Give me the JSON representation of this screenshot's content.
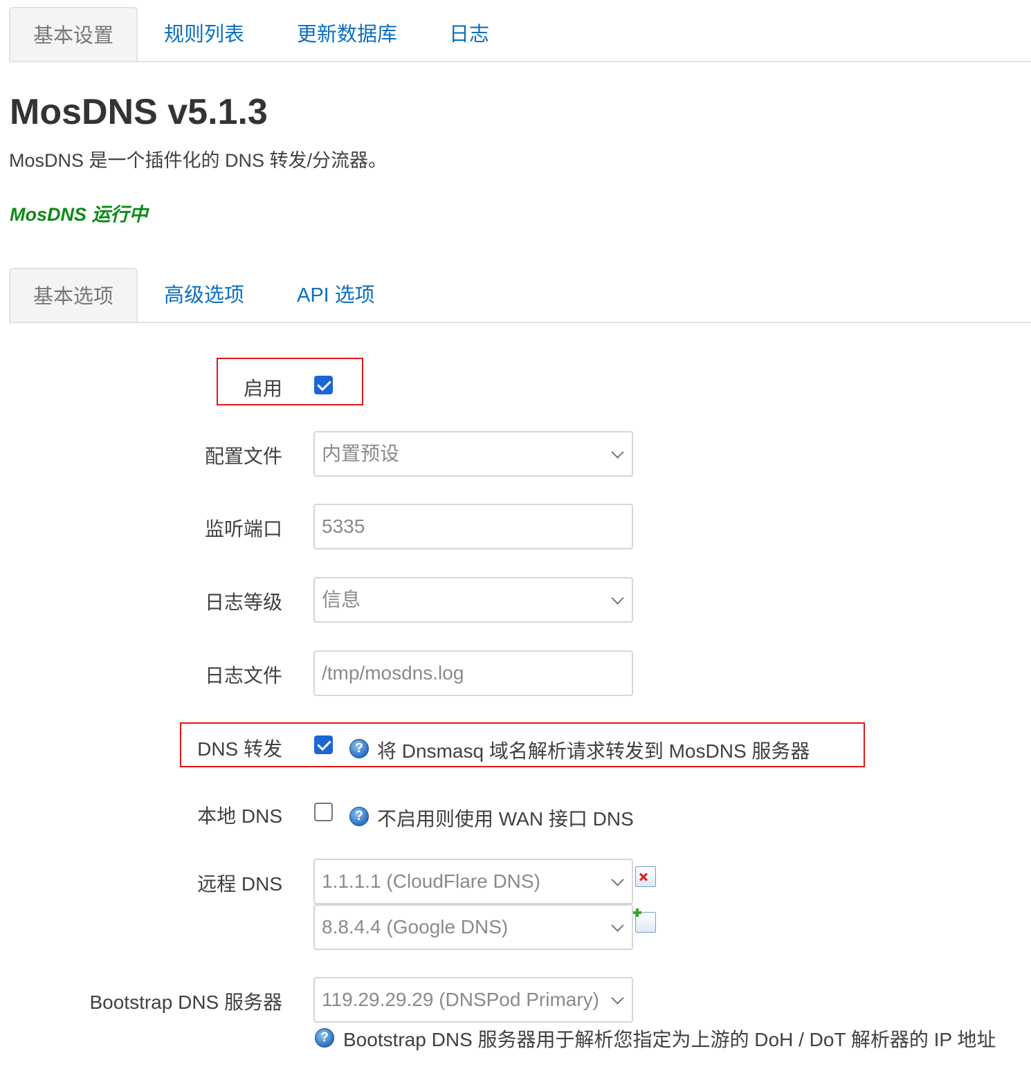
{
  "top_tabs": [
    "基本设置",
    "规则列表",
    "更新数据库",
    "日志"
  ],
  "title": "MosDNS v5.1.3",
  "description": "MosDNS 是一个插件化的 DNS 转发/分流器。",
  "status": "MosDNS 运行中",
  "sub_tabs": [
    "基本选项",
    "高级选项",
    "API 选项"
  ],
  "form": {
    "enable": {
      "label": "启用",
      "checked": true
    },
    "config_file": {
      "label": "配置文件",
      "value": "内置预设"
    },
    "listen_port": {
      "label": "监听端口",
      "value": "5335"
    },
    "log_level": {
      "label": "日志等级",
      "value": "信息"
    },
    "log_file": {
      "label": "日志文件",
      "value": "/tmp/mosdns.log"
    },
    "dns_forward": {
      "label": "DNS 转发",
      "checked": true,
      "help": "将 Dnsmasq 域名解析请求转发到 MosDNS 服务器"
    },
    "local_dns": {
      "label": "本地 DNS",
      "checked": false,
      "help": "不启用则使用 WAN 接口 DNS"
    },
    "remote_dns": {
      "label": "远程 DNS",
      "values": [
        "1.1.1.1 (CloudFlare DNS)",
        "8.8.4.4 (Google DNS)"
      ]
    },
    "bootstrap_dns": {
      "label": "Bootstrap DNS 服务器",
      "value": "119.29.29.29 (DNSPod Primary)",
      "help": "Bootstrap DNS 服务器用于解析您指定为上游的 DoH / DoT 解析器的 IP 地址"
    }
  },
  "help_icon_glyph": "?",
  "colors": {
    "link": "#0a6fc2",
    "status_green": "#0a8a16",
    "highlight_red": "#e21616",
    "checkbox_blue": "#1b66d6"
  }
}
